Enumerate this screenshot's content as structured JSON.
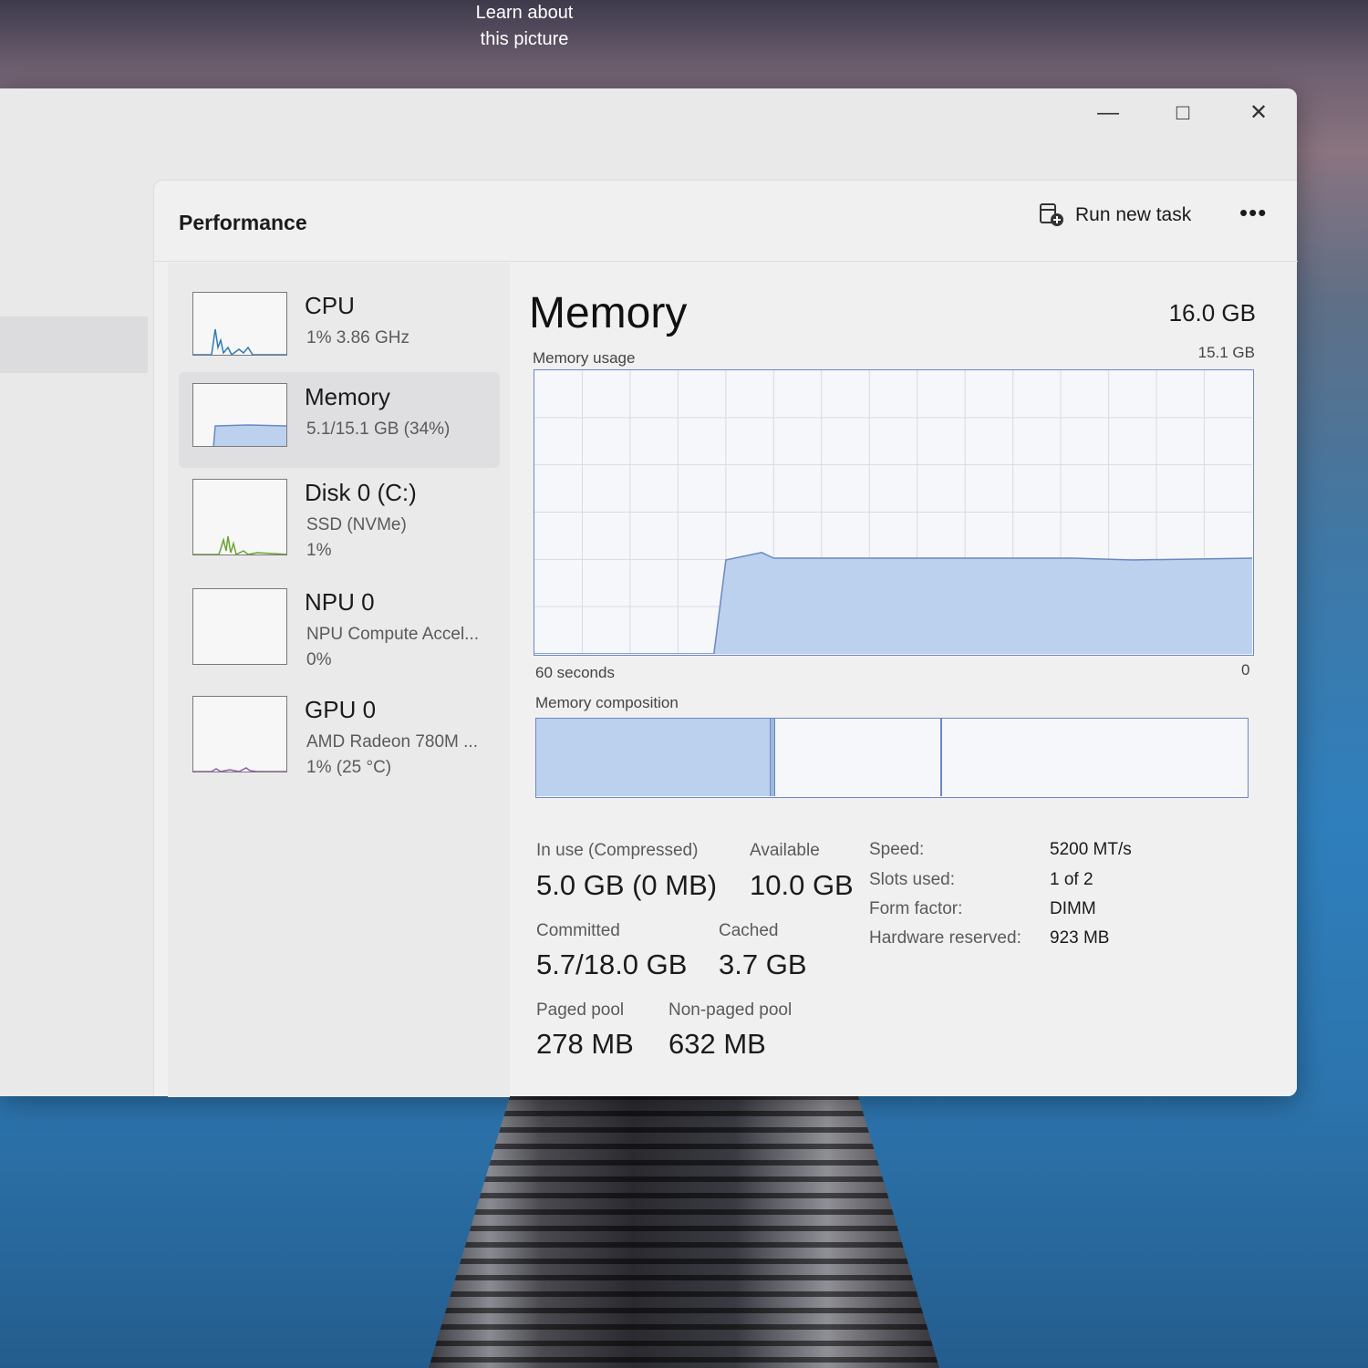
{
  "wallpaper": {
    "learn_line1": "Learn about",
    "learn_line2": "this picture"
  },
  "window": {
    "minimize": "—",
    "maximize": "□",
    "close": "✕"
  },
  "header": {
    "title": "Performance",
    "run_new_task": "Run new task",
    "more": "•••"
  },
  "sidebar": {
    "items": [
      {
        "name": "CPU",
        "sub1": "1%  3.86 GHz",
        "sub2": ""
      },
      {
        "name": "Memory",
        "sub1": "5.1/15.1 GB (34%)",
        "sub2": ""
      },
      {
        "name": "Disk 0 (C:)",
        "sub1": "SSD (NVMe)",
        "sub2": "1%"
      },
      {
        "name": "NPU 0",
        "sub1": "NPU Compute Accel...",
        "sub2": "0%"
      },
      {
        "name": "GPU 0",
        "sub1": "AMD Radeon 780M ...",
        "sub2": "1%  (25 °C)"
      }
    ]
  },
  "main": {
    "title": "Memory",
    "total": "16.0 GB",
    "usage_label": "Memory usage",
    "usage_max": "15.1 GB",
    "time_left": "60 seconds",
    "time_right": "0",
    "composition_label": "Memory composition",
    "stats": {
      "in_use_label": "In use (Compressed)",
      "in_use_value": "5.0 GB (0 MB)",
      "available_label": "Available",
      "available_value": "10.0 GB",
      "committed_label": "Committed",
      "committed_value": "5.7/18.0 GB",
      "cached_label": "Cached",
      "cached_value": "3.7 GB",
      "paged_label": "Paged pool",
      "paged_value": "278 MB",
      "nonpaged_label": "Non-paged pool",
      "nonpaged_value": "632 MB"
    },
    "specs": [
      {
        "label": "Speed:",
        "value": "5200 MT/s"
      },
      {
        "label": "Slots used:",
        "value": "1 of 2"
      },
      {
        "label": "Form factor:",
        "value": "DIMM"
      },
      {
        "label": "Hardware reserved:",
        "value": "923 MB"
      }
    ]
  },
  "colors": {
    "accent": "#6c87c4",
    "fill": "#bcd1ee",
    "window_bg": "#e9e9ea"
  },
  "chart_data": {
    "type": "area",
    "title": "Memory usage",
    "xlabel": "60 seconds",
    "ylabel": "",
    "ylim": [
      0,
      15.1
    ],
    "x": [
      60,
      58.5,
      45,
      44,
      41,
      40,
      35,
      25,
      15,
      10,
      0
    ],
    "values": [
      0,
      0,
      0,
      5.0,
      5.4,
      5.1,
      5.1,
      5.1,
      5.1,
      5.0,
      5.1
    ],
    "grid": true
  }
}
